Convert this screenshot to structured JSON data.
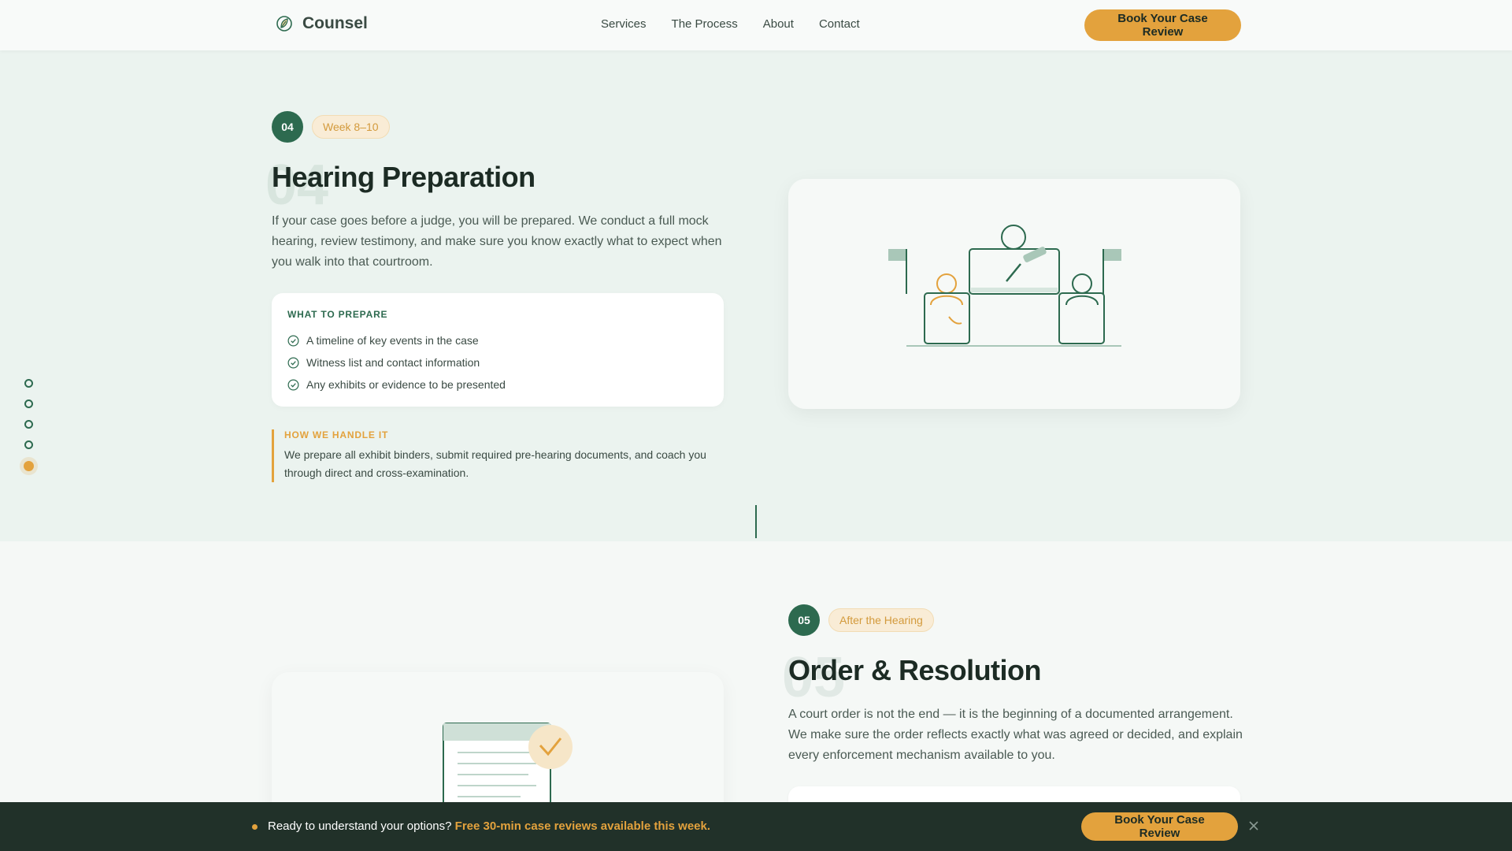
{
  "nav": {
    "brand": "Counsel",
    "links": [
      "Services",
      "The Process",
      "About",
      "Contact"
    ],
    "cta": "Book Your Case Review"
  },
  "step4": {
    "number": "04",
    "ghost": "04",
    "timeframe": "Week 8–10",
    "title": "Hearing Preparation",
    "description": "If your case goes before a judge, you will be prepared. We conduct a full mock hearing, review testimony, and make sure you know exactly what to expect when you walk into that courtroom.",
    "prepare_title": "WHAT TO PREPARE",
    "prepare_items": [
      "A timeline of key events in the case",
      "Witness list and contact information",
      "Any exhibits or evidence to be presented"
    ],
    "handle_title": "HOW WE HANDLE IT",
    "handle_text": "We prepare all exhibit binders, submit required pre-hearing documents, and coach you through direct and cross-examination."
  },
  "step5": {
    "number": "05",
    "ghost": "05",
    "timeframe": "After the Hearing",
    "title": "Order & Resolution",
    "description": "A court order is not the end — it is the beginning of a documented arrangement. We make sure the order reflects exactly what was agreed or decided, and explain every enforcement mechanism available to you."
  },
  "progress": {
    "total_steps": 5,
    "active_step": 5
  },
  "banner": {
    "text": "Ready to understand your options?",
    "highlight": "Free 30-min case reviews available this week.",
    "cta": "Book Your Case Review"
  },
  "colors": {
    "primary_green": "#2d6a4f",
    "accent_amber": "#e3a23d",
    "banner_bg": "#213129"
  }
}
